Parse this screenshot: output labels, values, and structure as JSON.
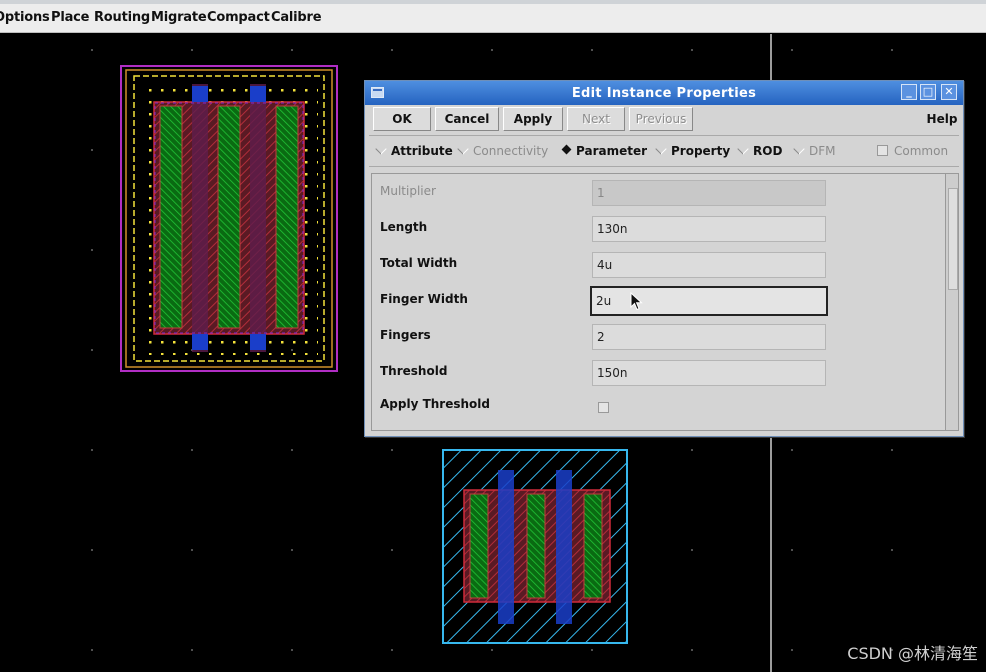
{
  "menu": {
    "items": [
      "Options",
      "Place",
      "Routing",
      "Migrate",
      "Compact",
      "Calibre"
    ]
  },
  "dialog": {
    "title": "Edit Instance Properties",
    "window_controls": [
      "minimize",
      "maximize",
      "close"
    ],
    "buttons": {
      "ok": "OK",
      "cancel": "Cancel",
      "apply": "Apply",
      "next": "Next",
      "previous": "Previous",
      "help": "Help"
    },
    "tabs": {
      "attribute": "Attribute",
      "connectivity": "Connectivity",
      "parameter": "Parameter",
      "property": "Property",
      "rod": "ROD",
      "dfm": "DFM",
      "common": "Common",
      "selected": "Parameter"
    },
    "fields": [
      {
        "label": "Multiplier",
        "value": "1",
        "disabled": true
      },
      {
        "label": "Length",
        "value": "130n"
      },
      {
        "label": "Total Width",
        "value": "4u"
      },
      {
        "label": "Finger Width",
        "value": "2u",
        "focused": true
      },
      {
        "label": "Fingers",
        "value": "2"
      },
      {
        "label": "Threshold",
        "value": "150n"
      }
    ],
    "apply_threshold": {
      "label": "Apply Threshold",
      "checked": false
    }
  },
  "colors": {
    "titlebar": "#2f6fd0",
    "dialog_bg": "#d4d4d4",
    "canvas_bg": "#000000"
  },
  "watermark": "CSDN @林清海笙"
}
